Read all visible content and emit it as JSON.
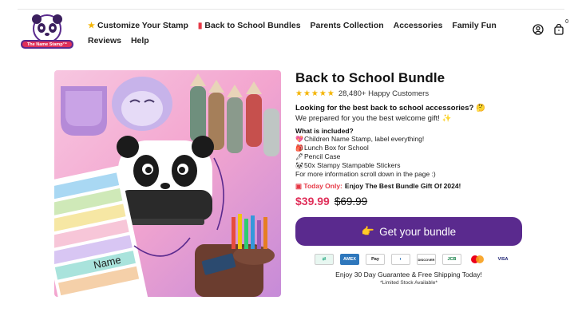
{
  "brand": {
    "name": "The Name Stamp™"
  },
  "nav": {
    "items": [
      {
        "icon": "star-icon",
        "label": "Customize Your Stamp"
      },
      {
        "icon": "backpack-icon",
        "label": "Back to School Bundles"
      },
      {
        "icon": "",
        "label": "Parents Collection"
      },
      {
        "icon": "",
        "label": "Accessories"
      },
      {
        "icon": "",
        "label": "Family Fun"
      },
      {
        "icon": "",
        "label": "Reviews"
      },
      {
        "icon": "",
        "label": "Help"
      }
    ],
    "cart_count": "0"
  },
  "product": {
    "title": "Back to School Bundle",
    "rating_stars": 5,
    "customers": "28,480+ Happy Customers",
    "headline": "Looking for the best back to school accessories? 🤔",
    "subline": "We prepared for you the best welcome gift! ✨",
    "included_title": "What is included?",
    "included": [
      {
        "icon": "💖",
        "text": "Children Name Stamp, label everything!"
      },
      {
        "icon": "🎒",
        "text": "Lunch Box for School"
      },
      {
        "icon": "🖊",
        "text": "Pencil Case"
      },
      {
        "icon": "🐼",
        "text": "50x Stampy Stampable Stickers"
      },
      {
        "icon": "",
        "text": "For more information scroll down in the page :)"
      }
    ],
    "promo_label": "Today Only:",
    "promo_text": "Enjoy The Best Bundle Gift Of 2024!",
    "price_now": "$39.99",
    "price_was": "$69.99",
    "cta": "Get your bundle",
    "payments": [
      "AMEX",
      "Pay",
      "DISCOVER",
      "JCB",
      "VISA"
    ],
    "guarantee": "Enjoy 30 Day Guarantee & Free Shipping Today!",
    "limited": "*Limited Stock Available*"
  },
  "colors": {
    "accent": "#5a2a8e",
    "price": "#e0305a",
    "star": "#f4b400"
  }
}
